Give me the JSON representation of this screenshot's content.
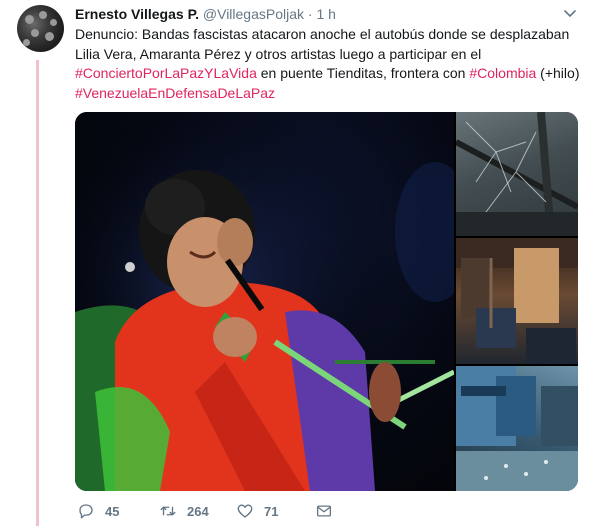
{
  "tweet": {
    "author_name": "Ernesto Villegas P.",
    "handle": "@VillegasPoljak",
    "separator": "·",
    "time": "1 h",
    "text_lines": [
      [
        {
          "t": "Denuncio: Bandas fascistas atacaron anoche el autobús donde se desplazaban",
          "tag": false
        }
      ],
      [
        {
          "t": "Lilia Vera, Amaranta Pérez y otros artistas luego a participar en el",
          "tag": false
        }
      ],
      [
        {
          "t": "#ConciertoPorLaPazYLaVida",
          "tag": true
        },
        {
          "t": " en puente Tienditas, frontera con ",
          "tag": false
        },
        {
          "t": "#Colombia",
          "tag": true
        },
        {
          "t": " (+hilo)",
          "tag": false
        }
      ],
      [
        {
          "t": "#VenezuelaEnDefensaDeLaPaz",
          "tag": true
        }
      ]
    ]
  },
  "media": {
    "main_photo_icon": "singer-photo",
    "side_photos": [
      "shattered-window-photo",
      "bus-interior-photo",
      "broken-glass-seats-photo"
    ]
  },
  "actions": {
    "reply_count": "45",
    "retweet_count": "264",
    "like_count": "71"
  },
  "colors": {
    "hashtag": "#e0245e",
    "muted": "#657786",
    "thread_line": "#f0c2c9"
  }
}
